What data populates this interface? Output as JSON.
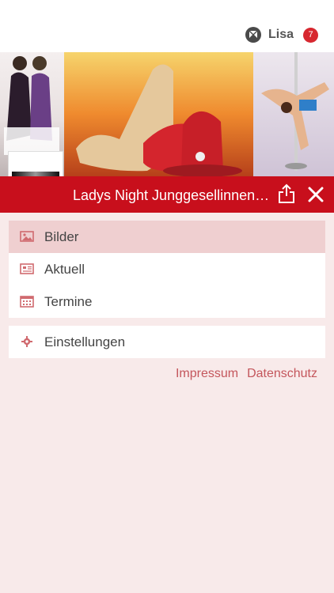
{
  "header": {
    "user_name": "Lisa",
    "notification_count": "7"
  },
  "group": {
    "title": "Ladys Night Junggesellinnena..."
  },
  "menu": {
    "items": [
      {
        "label": "Bilder",
        "icon": "image-icon",
        "active": true
      },
      {
        "label": "Aktuell",
        "icon": "newspaper-icon",
        "active": false
      },
      {
        "label": "Termine",
        "icon": "calendar-icon",
        "active": false
      }
    ],
    "settings": {
      "label": "Einstellungen",
      "icon": "gear-icon"
    }
  },
  "footer_links": {
    "impressum": "Impressum",
    "datenschutz": "Datenschutz"
  },
  "colors": {
    "accent": "#c80f1c",
    "background": "#f8eaea",
    "active_row": "#efcfd0",
    "link": "#c4565c"
  }
}
